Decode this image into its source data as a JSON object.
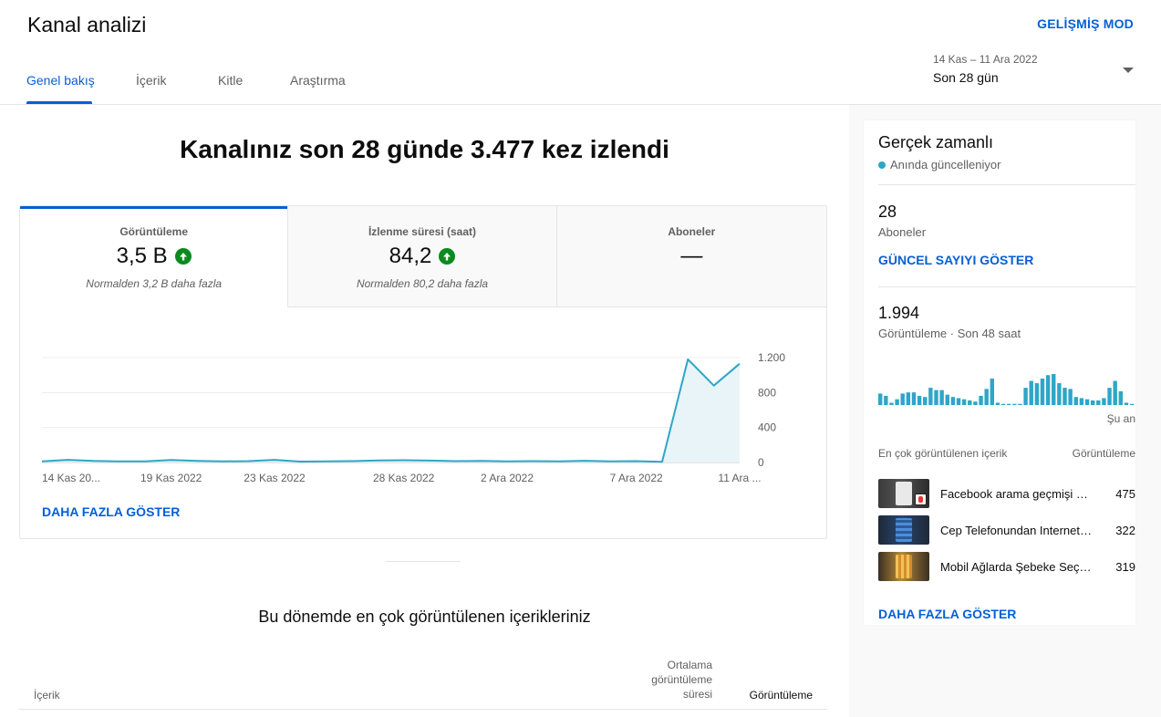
{
  "header": {
    "title": "Kanal analizi",
    "advanced_mode": "GELİŞMİŞ MOD",
    "tabs": [
      "Genel bakış",
      "İçerik",
      "Kitle",
      "Araştırma"
    ],
    "active_tab": 0,
    "date_range": "14 Kas – 11 Ara 2022",
    "date_label": "Son 28 gün"
  },
  "main": {
    "headline": "Kanalınız son 28 günde 3.477 kez izlendi",
    "metrics": [
      {
        "label": "Görüntüleme",
        "value": "3,5 B",
        "trend": "up",
        "note": "Normalden 3,2 B daha fazla"
      },
      {
        "label": "İzlenme süresi (saat)",
        "value": "84,2",
        "trend": "up",
        "note": "Normalden 80,2 daha fazla"
      },
      {
        "label": "Aboneler",
        "value": "—",
        "trend": "",
        "note": ""
      }
    ],
    "more_link": "DAHA FAZLA GÖSTER",
    "section_title": "Bu dönemde en çok görüntülenen içerikleriniz",
    "table_headers": {
      "content": "İçerik",
      "avg_duration": "Ortalama görüntüleme süresi",
      "views": "Görüntüleme"
    }
  },
  "chart_data": {
    "type": "area",
    "x": [
      "14 Kas",
      "15 Kas",
      "16 Kas",
      "17 Kas",
      "18 Kas",
      "19 Kas",
      "20 Kas",
      "21 Kas",
      "22 Kas",
      "23 Kas",
      "24 Kas",
      "25 Kas",
      "26 Kas",
      "27 Kas",
      "28 Kas",
      "29 Kas",
      "30 Kas",
      "1 Ara",
      "2 Ara",
      "3 Ara",
      "4 Ara",
      "5 Ara",
      "6 Ara",
      "7 Ara",
      "8 Ara",
      "9 Ara",
      "10 Ara",
      "11 Ara"
    ],
    "values": [
      12,
      30,
      18,
      12,
      14,
      28,
      18,
      12,
      16,
      30,
      10,
      12,
      16,
      24,
      26,
      22,
      16,
      18,
      12,
      16,
      12,
      20,
      14,
      16,
      8,
      1180,
      880,
      1130
    ],
    "x_tick_labels": [
      "14 Kas 20...",
      "19 Kas 2022",
      "23 Kas 2022",
      "28 Kas 2022",
      "2 Ara 2022",
      "7 Ara 2022",
      "11 Ara ..."
    ],
    "x_tick_index": [
      0,
      5,
      9,
      14,
      18,
      23,
      27
    ],
    "y_ticks": [
      "1.200",
      "800",
      "400",
      "0"
    ],
    "y_tick_values": [
      1200,
      800,
      400,
      0
    ],
    "ylim": [
      0,
      1200
    ],
    "grid": true,
    "color": "#2ea6c7",
    "fill": "#e8f4f8"
  },
  "realtime": {
    "title": "Gerçek zamanlı",
    "live_label": "Anında güncelleniyor",
    "subscribers_value": "28",
    "subscribers_label": "Aboneler",
    "show_count_link": "GÜNCEL SAYIYI GÖSTER",
    "views_value": "1.994",
    "views_label": "Görüntüleme · Son 48 saat",
    "now_label": "Şu an",
    "mini_chart_values": [
      10,
      8,
      2,
      5,
      10,
      11,
      11,
      8,
      7,
      15,
      13,
      13,
      9,
      7,
      6,
      5,
      4,
      3,
      8,
      14,
      23,
      2,
      1,
      1,
      1,
      1,
      15,
      21,
      19,
      23,
      26,
      27,
      19,
      15,
      14,
      7,
      6,
      5,
      4,
      4,
      6,
      15,
      21,
      12,
      2,
      1
    ],
    "list_head_content": "En çok görüntülenen içerik",
    "list_head_views": "Görüntüleme",
    "items": [
      {
        "title": "Facebook arama geçmişi nasıl silinir",
        "views": "475"
      },
      {
        "title": "Cep Telefonundan Internet Paylaşımı",
        "views": "322"
      },
      {
        "title": "Mobil Ağlarda Şebeke Seçimi",
        "views": "319"
      }
    ],
    "more_link": "DAHA FAZLA GÖSTER"
  }
}
